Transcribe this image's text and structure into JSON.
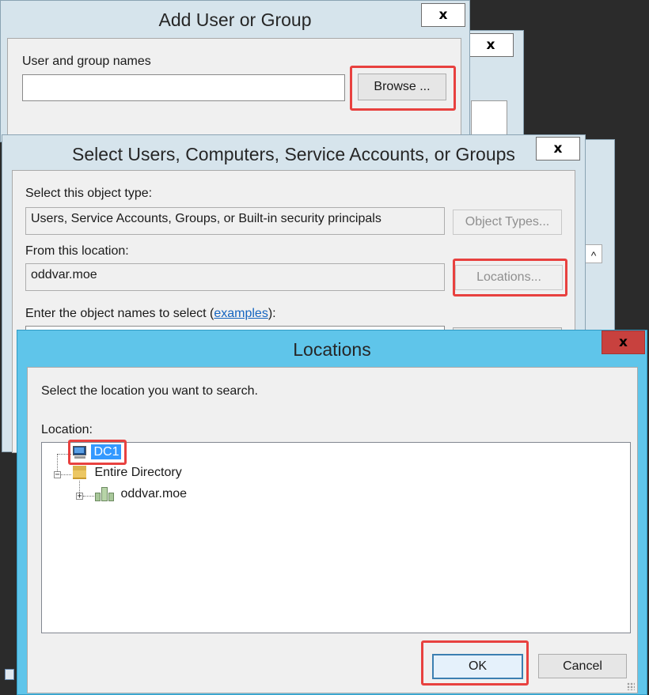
{
  "colors": {
    "desktop": "#2b2b2b",
    "dialog_frame": "#d6e4ec",
    "locations_frame": "#5fc5ea",
    "close_red": "#c8413e",
    "highlight_red": "#e8413f",
    "selection_blue": "#3399ff",
    "link_blue": "#1565c0"
  },
  "add_user": {
    "title": "Add User or Group",
    "close_glyph": "x",
    "names_label": "User and group names",
    "names_value": "",
    "browse_label": "Browse ..."
  },
  "back_dialog": {
    "close_glyph": "x"
  },
  "select_users": {
    "title": "Select Users, Computers, Service Accounts, or Groups",
    "close_glyph": "x",
    "object_type_label": "Select this object type:",
    "object_type_value": "Users, Service Accounts, Groups, or Built-in security principals",
    "object_types_button": "Object Types...",
    "location_label": "From this location:",
    "location_value": "oddvar.moe",
    "locations_button": "Locations...",
    "names_prompt_prefix": "Enter the object names to select (",
    "examples_link": "examples",
    "names_prompt_suffix": "):",
    "scroll_up_glyph": "^"
  },
  "locations": {
    "title": "Locations",
    "close_glyph": "x",
    "instruction": "Select the location you want to search.",
    "location_label": "Location:",
    "tree": [
      {
        "label": "DC1",
        "icon": "computer-icon",
        "selected": true
      },
      {
        "label": "Entire Directory",
        "icon": "folder-icon",
        "expanded": true,
        "expander": "−"
      },
      {
        "label": "oddvar.moe",
        "icon": "domain-icon",
        "expanded": false,
        "expander": "+"
      }
    ],
    "ok_label": "OK",
    "cancel_label": "Cancel"
  }
}
